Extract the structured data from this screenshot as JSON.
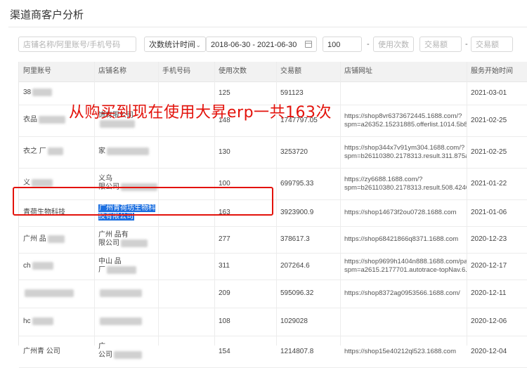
{
  "page_title": "渠道商客户分析",
  "filters": {
    "shop_search_placeholder": "店铺名称/阿里账号/手机号码",
    "count_select_value": "次数统计时间",
    "date_range_value": "2018-06-30 - 2021-06-30",
    "min_count_value": "100",
    "range_dash_1": "-",
    "max_count_placeholder": "使用次数",
    "min_amount_placeholder": "交易额",
    "range_dash_2": "-",
    "max_amount_placeholder": "交易额"
  },
  "table": {
    "headers": [
      "阿里账号",
      "店铺名称",
      "手机号码",
      "使用次数",
      "交易额",
      "店铺网址",
      "服务开始时间"
    ],
    "rows": [
      {
        "account": "38",
        "shop": "",
        "phone": "",
        "count": "125",
        "amount": "591123",
        "url": "",
        "start": "2021-03-01"
      },
      {
        "account": "衣品",
        "shop": "饰有限公司",
        "phone": "",
        "count": "148",
        "amount": "1747797.05",
        "url": "https://shop8vr6373672445.1688.com/?spm=a26352.15231885.offerlist.1014.5b8acdcbpEGC23",
        "start": "2021-02-25"
      },
      {
        "account": "衣之 厂",
        "shop": "家",
        "phone": "",
        "count": "130",
        "amount": "3253720",
        "url": "https://shop344x7v91ym304.1688.com/?spm=b26110380.2178313.result.311.875a42a4mPlp8h",
        "start": "2021-02-25"
      },
      {
        "account": "义",
        "shop": "义乌\n限公司",
        "phone": "",
        "count": "100",
        "amount": "699795.33",
        "url": "https://zy6688.1688.com/?spm=b26110380.2178313.result.508.42407de6Ta6RzG",
        "start": "2021-01-22"
      },
      {
        "account": "青荷生物科技",
        "shop": "广州青荷坊生物科技有限公司",
        "phone": "",
        "count": "163",
        "amount": "3923900.9",
        "url": "https://shop14673f2ou0728.1688.com",
        "start": "2021-01-06"
      },
      {
        "account": "广州 品",
        "shop": "广州 品有\n限公司",
        "phone": "",
        "count": "277",
        "amount": "378617.3",
        "url": "https://shop68421866q8371.1688.com",
        "start": "2020-12-23"
      },
      {
        "account": "ch",
        "shop": "中山 品\n厂",
        "phone": "",
        "count": "311",
        "amount": "207264.6",
        "url": "https://shop9699h1404n888.1688.com/page/contactinfo.htm?spm=a2615.2177701.autotrace-topNav.6.55a3395bludvAG",
        "start": "2020-12-17"
      },
      {
        "account": "",
        "shop": "",
        "phone": "",
        "count": "209",
        "amount": "595096.32",
        "url": "https://shop8372ag0953566.1688.com/",
        "start": "2020-12-11"
      },
      {
        "account": "hc",
        "shop": "",
        "phone": "",
        "count": "108",
        "amount": "1029028",
        "url": "",
        "start": "2020-12-06"
      },
      {
        "account": "广州青 公司",
        "shop": "广\n公司",
        "phone": "",
        "count": "154",
        "amount": "1214807.8",
        "url": "https://shop15e40212ql523.1688.com",
        "start": "2020-12-04"
      }
    ]
  },
  "annotation": {
    "text": "从购买到现在使用大昇erp一共163次",
    "color": "#e3120b"
  },
  "colors": {
    "accent": "#e3120b",
    "selection": "#1c6fe0",
    "header_bg": "#f2f2f2"
  }
}
